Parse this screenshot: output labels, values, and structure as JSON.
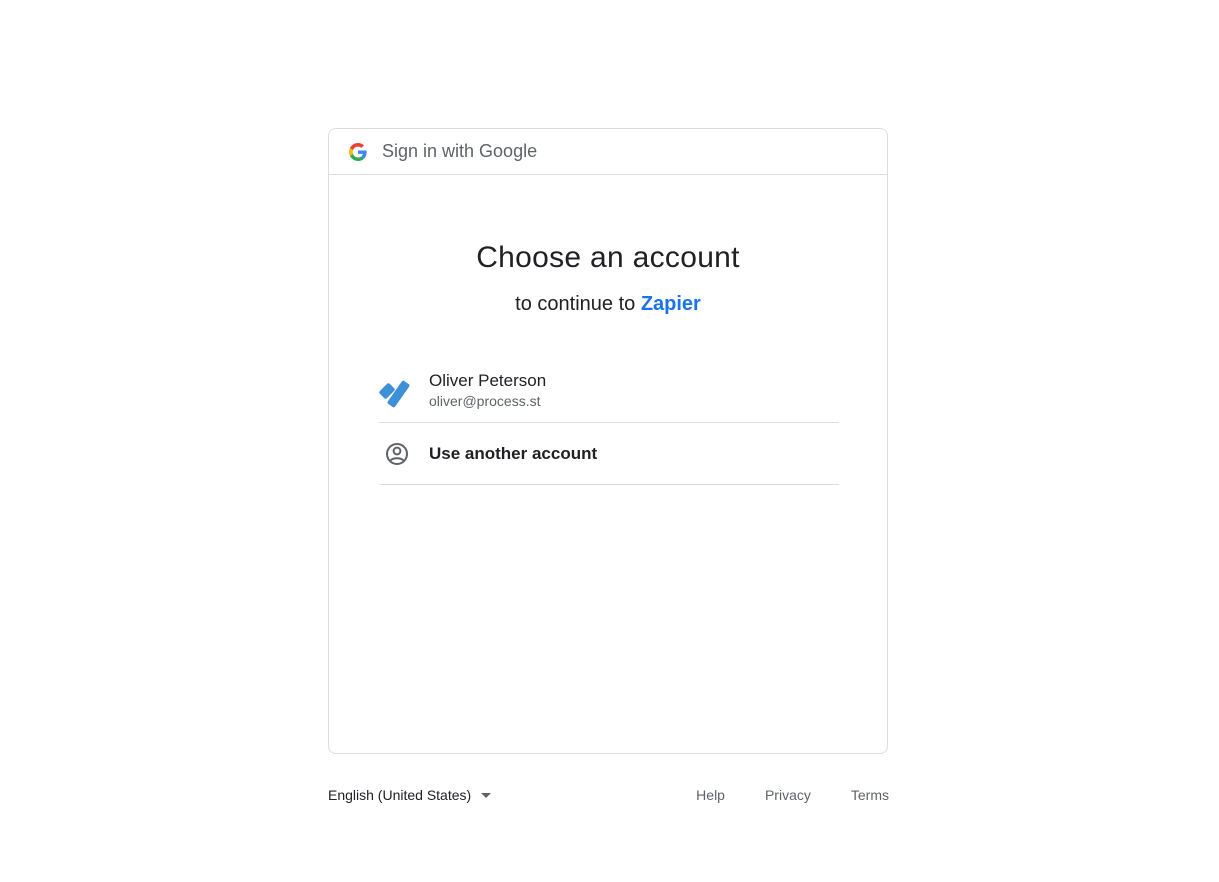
{
  "header": {
    "text": "Sign in with Google"
  },
  "main": {
    "title": "Choose an account",
    "subtitle_prefix": "to continue to ",
    "app_name": "Zapier"
  },
  "accounts": [
    {
      "name": "Oliver Peterson",
      "email": "oliver@process.st",
      "avatar_icon": "process-street-logo-icon"
    }
  ],
  "use_another": {
    "label": "Use another account",
    "icon": "account-circle-icon"
  },
  "footer": {
    "language": "English (United States)",
    "links": [
      "Help",
      "Privacy",
      "Terms"
    ]
  },
  "colors": {
    "link_blue": "#1a73e8",
    "avatar_blue": "#3d8fd8",
    "border": "#dadce0",
    "text": "#202124",
    "muted": "#5f6368"
  }
}
